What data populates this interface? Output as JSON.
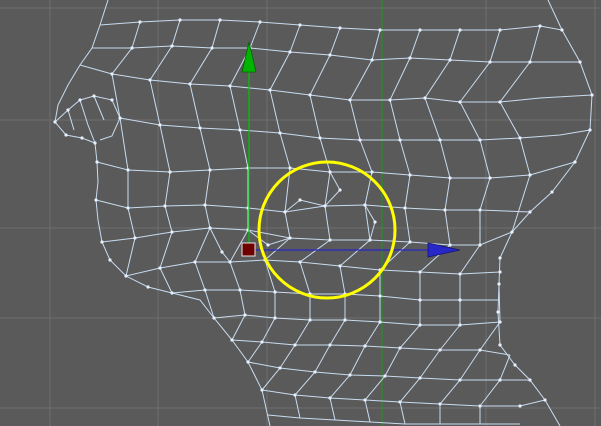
{
  "viewport": {
    "view": "side",
    "colors": {
      "background": "#5a5a5a",
      "grid": "#6e6e6e",
      "mesh_wire": "#c8dcf0",
      "mesh_vertex": "#e6f0ff",
      "axis_y": "#00c800",
      "axis_z": "#2828c8",
      "brush_circle": "#ffff00",
      "pivot": "#6e0000"
    }
  },
  "gizmo": {
    "icons": [
      "translate-arrow-y-icon",
      "translate-arrow-z-icon",
      "pivot-handle-icon"
    ]
  },
  "brush": {
    "shape": "circle"
  }
}
